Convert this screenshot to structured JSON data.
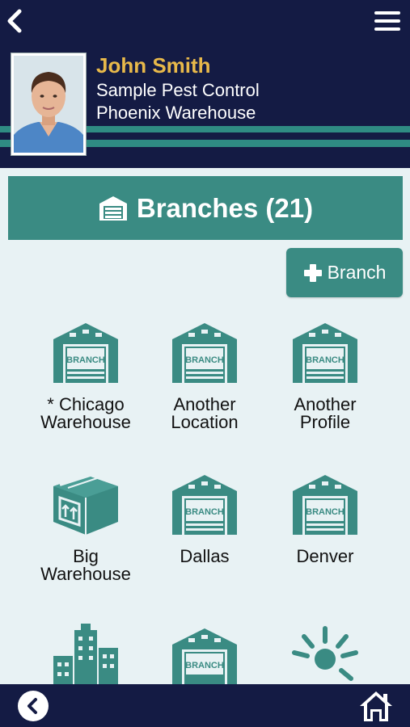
{
  "header": {
    "back_icon": "chevron-left-icon",
    "menu_icon": "hamburger-menu-icon",
    "user": {
      "name": "John Smith",
      "company": "Sample Pest Control",
      "location": "Phoenix Warehouse",
      "name_color": "#e8b94a"
    }
  },
  "title_bar": {
    "title": "Branches (21)",
    "icon": "warehouse-icon"
  },
  "add_button": {
    "label": "Branch",
    "icon": "plus-icon"
  },
  "branches": [
    {
      "label_line1": "* Chicago",
      "label_line2": "Warehouse",
      "icon": "garage-branch-icon",
      "icon_text": "BRANCH"
    },
    {
      "label_line1": "Another",
      "label_line2": "Location",
      "icon": "garage-branch-icon",
      "icon_text": "BRANCH"
    },
    {
      "label_line1": "Another",
      "label_line2": "Profile",
      "icon": "garage-branch-icon",
      "icon_text": "BRANCH"
    },
    {
      "label_line1": "Big",
      "label_line2": "Warehouse",
      "icon": "box-icon"
    },
    {
      "label_line1": "Dallas",
      "label_line2": "",
      "icon": "garage-branch-icon",
      "icon_text": "BRANCH"
    },
    {
      "label_line1": "Denver",
      "label_line2": "",
      "icon": "garage-branch-icon",
      "icon_text": "BRANCH"
    },
    {
      "label_line1": "",
      "label_line2": "",
      "icon": "city-buildings-icon"
    },
    {
      "label_line1": "",
      "label_line2": "",
      "icon": "garage-branch-icon",
      "icon_text": "BRANCH"
    },
    {
      "label_line1": "",
      "label_line2": "",
      "icon": "sun-icon"
    }
  ],
  "footer": {
    "back_icon": "circle-back-icon",
    "home_icon": "home-icon"
  },
  "colors": {
    "navy": "#141b44",
    "teal": "#3a8b83",
    "background": "#e8f2f4"
  }
}
